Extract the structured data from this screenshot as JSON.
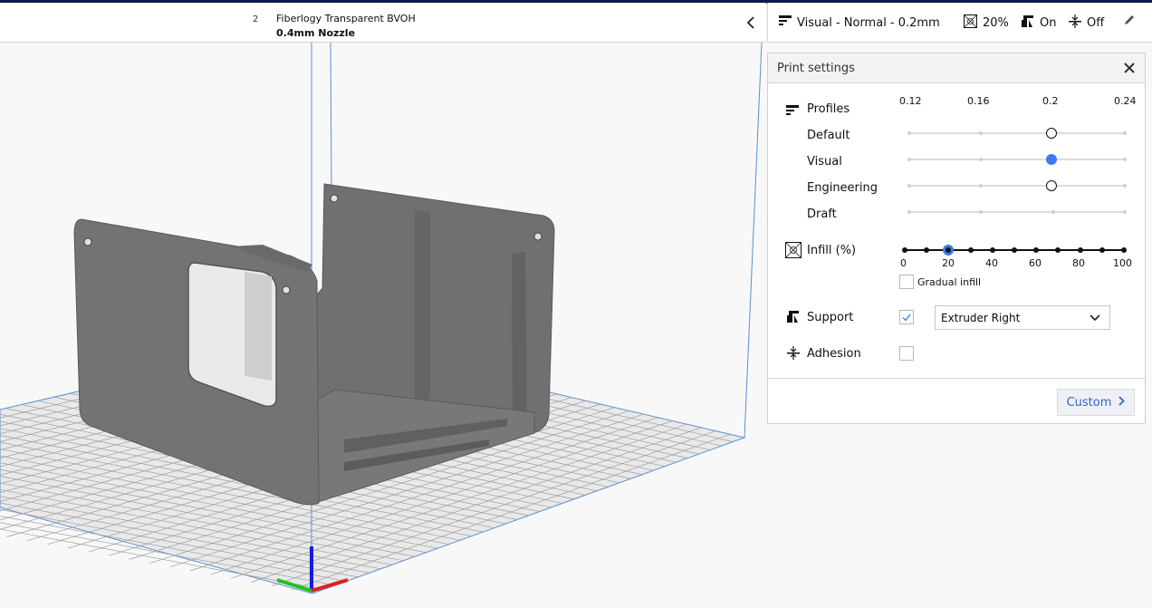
{
  "extruder": {
    "number": "2",
    "material": "Fiberlogy Transparent BVOH",
    "nozzle": "0.4mm Nozzle"
  },
  "settings_bar": {
    "profile": "Visual - Normal - 0.2mm",
    "infill": "20%",
    "support": "On",
    "adhesion": "Off"
  },
  "panel": {
    "title": "Print settings",
    "profiles_label": "Profiles",
    "layer_heights": [
      "0.12",
      "0.16",
      "0.2",
      "0.24"
    ],
    "profile_rows": [
      {
        "name": "Default",
        "selected_layer": 0.2,
        "active": false
      },
      {
        "name": "Visual",
        "selected_layer": 0.2,
        "active": true
      },
      {
        "name": "Engineering",
        "selected_layer": 0.2,
        "active": false
      },
      {
        "name": "Draft",
        "selected_layer": null,
        "active": false
      }
    ],
    "infill_label": "Infill (%)",
    "infill_ticks": [
      "0",
      "20",
      "40",
      "60",
      "80",
      "100"
    ],
    "infill_value": 20,
    "gradual_infill_label": "Gradual infill",
    "gradual_infill_checked": false,
    "support_label": "Support",
    "support_checked": true,
    "support_extruder": "Extruder Right",
    "adhesion_label": "Adhesion",
    "adhesion_checked": false,
    "custom_button": "Custom"
  },
  "colors": {
    "accent": "#3a7cf0",
    "top_strip": "#0d1a4a",
    "model": "#6e6e6e",
    "grid_line": "#9a9a9a",
    "build_volume_edge": "#5b8fd6"
  }
}
